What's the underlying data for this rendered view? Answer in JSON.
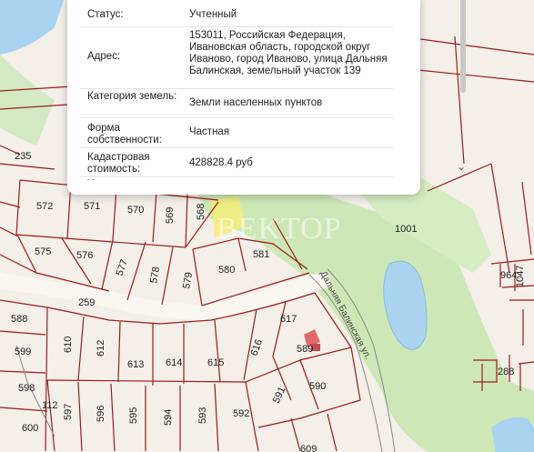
{
  "map": {
    "watermark": "BEKTOP",
    "street_label": "Дальняя Балинская ул.",
    "plots": [
      {
        "id": "p235",
        "label": "235"
      },
      {
        "id": "p572",
        "label": "572"
      },
      {
        "id": "p571",
        "label": "571"
      },
      {
        "id": "p570",
        "label": "570"
      },
      {
        "id": "p569",
        "label": "569"
      },
      {
        "id": "p568",
        "label": "568"
      },
      {
        "id": "p1001",
        "label": "1001"
      },
      {
        "id": "p575",
        "label": "575"
      },
      {
        "id": "p576",
        "label": "576"
      },
      {
        "id": "p577",
        "label": "577"
      },
      {
        "id": "p578",
        "label": "578"
      },
      {
        "id": "p579",
        "label": "579"
      },
      {
        "id": "p580",
        "label": "580"
      },
      {
        "id": "p581",
        "label": "581"
      },
      {
        "id": "p964",
        "label": "964"
      },
      {
        "id": "p1047",
        "label": "1047"
      },
      {
        "id": "p259",
        "label": "259"
      },
      {
        "id": "p588",
        "label": "588"
      },
      {
        "id": "p617",
        "label": "617"
      },
      {
        "id": "p610",
        "label": "610"
      },
      {
        "id": "p612",
        "label": "612"
      },
      {
        "id": "p599",
        "label": "599"
      },
      {
        "id": "p613",
        "label": "613"
      },
      {
        "id": "p614",
        "label": "614"
      },
      {
        "id": "p615",
        "label": "615"
      },
      {
        "id": "p616",
        "label": "616"
      },
      {
        "id": "p589",
        "label": "589"
      },
      {
        "id": "p288",
        "label": "288"
      },
      {
        "id": "p598",
        "label": "598"
      },
      {
        "id": "p591",
        "label": "591"
      },
      {
        "id": "p590",
        "label": "590"
      },
      {
        "id": "p597",
        "label": "597"
      },
      {
        "id": "p596",
        "label": "596"
      },
      {
        "id": "p595",
        "label": "595"
      },
      {
        "id": "p594",
        "label": "594"
      },
      {
        "id": "p593",
        "label": "593"
      },
      {
        "id": "p592",
        "label": "592"
      },
      {
        "id": "p600",
        "label": "600"
      },
      {
        "id": "p112",
        "label": "112"
      },
      {
        "id": "p609",
        "label": "609"
      }
    ]
  },
  "popup": {
    "rows": [
      {
        "key": "Статус:",
        "value": "Учтенный"
      },
      {
        "key": "Адрес:",
        "value": "153011, Российская Федерация, Ивановская область, городской округ Иваново, город Иваново, улица Дальняя Балинская, земельный участок 139"
      },
      {
        "key": "Категория земель:",
        "value": "Земли населенных пунктов"
      },
      {
        "key": "Форма собственности:",
        "value": "Частная"
      },
      {
        "key": "Кадастровая стоимость:",
        "value": "428828.4 руб"
      },
      {
        "key": "Уточненная",
        "value": ""
      }
    ],
    "scroll_icon": "chevron-down-icon"
  }
}
